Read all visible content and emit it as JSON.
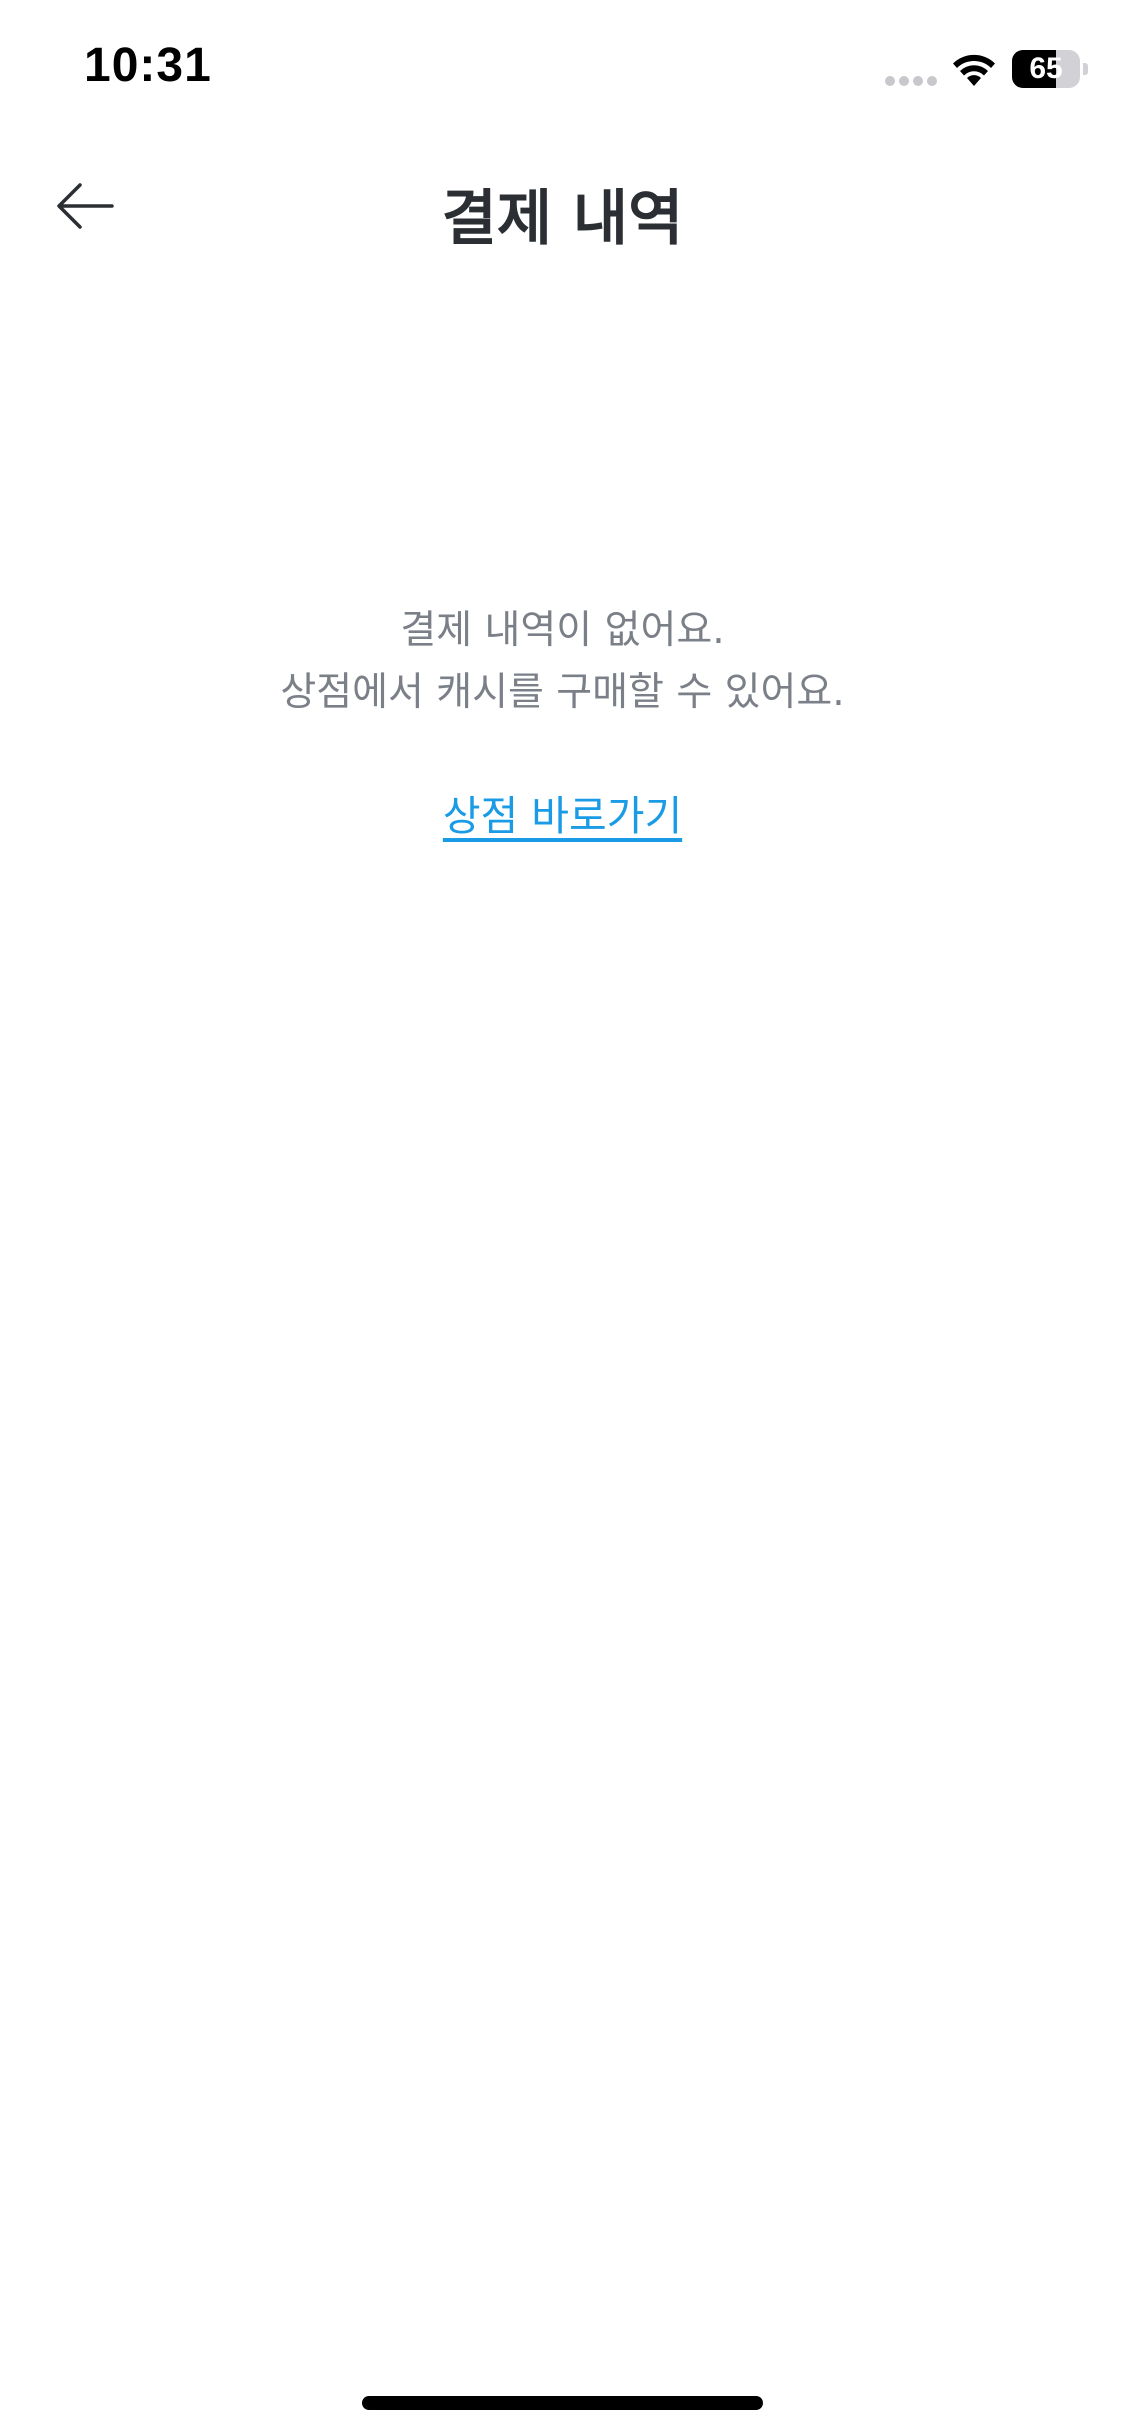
{
  "status_bar": {
    "time": "10:31",
    "battery_level": "65",
    "battery_fraction": 0.65,
    "icons": [
      "cellular-signal-icon",
      "wifi-icon",
      "battery-icon"
    ]
  },
  "nav": {
    "title": "결제 내역",
    "back_icon": "arrow-left-icon"
  },
  "empty_state": {
    "line1": "결제 내역이 없어요.",
    "line2": "상점에서 캐시를 구매할 수 있어요.",
    "link_label": "상점 바로가기"
  },
  "colors": {
    "title": "#2b2e33",
    "body_text": "#7b8088",
    "link": "#1a9be6",
    "background": "#ffffff"
  }
}
